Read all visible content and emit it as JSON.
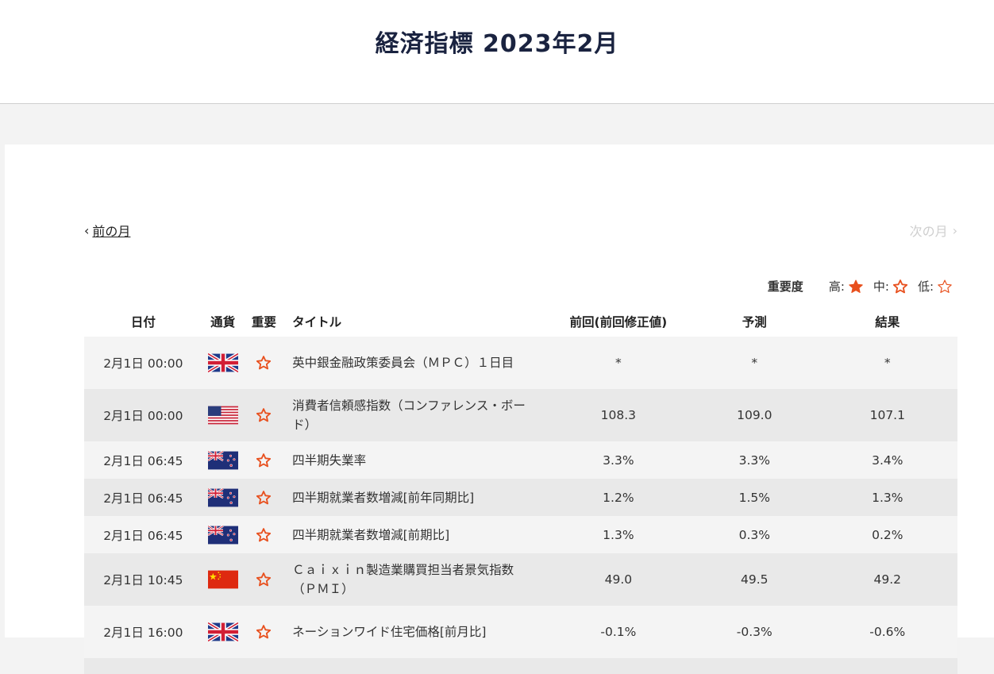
{
  "header": {
    "title": "経済指標 2023年2月"
  },
  "nav": {
    "prev_label": "前の月",
    "next_label": "次の月"
  },
  "legend": {
    "title": "重要度",
    "high": "高:",
    "mid": "中:",
    "low": "低:"
  },
  "table": {
    "headers": {
      "date": "日付",
      "currency": "通貨",
      "importance": "重要",
      "title": "タイトル",
      "previous": "前回(前回修正値)",
      "forecast": "予測",
      "result": "結果"
    },
    "rows": [
      {
        "date": "2月1日 00:00",
        "flag": "uk",
        "importance": "mid",
        "title": "英中銀金融政策委員会（ＭＰＣ）１日目",
        "previous": "*",
        "forecast": "*",
        "result": "*"
      },
      {
        "date": "2月1日 00:00",
        "flag": "us",
        "importance": "mid",
        "title": "消費者信頼感指数（コンファレンス・ボード）",
        "previous": "108.3",
        "forecast": "109.0",
        "result": "107.1"
      },
      {
        "date": "2月1日 06:45",
        "flag": "nz",
        "importance": "mid",
        "title": "四半期失業率",
        "previous": "3.3%",
        "forecast": "3.3%",
        "result": "3.4%"
      },
      {
        "date": "2月1日 06:45",
        "flag": "nz",
        "importance": "mid",
        "title": "四半期就業者数増減[前年同期比]",
        "previous": "1.2%",
        "forecast": "1.5%",
        "result": "1.3%"
      },
      {
        "date": "2月1日 06:45",
        "flag": "nz",
        "importance": "mid",
        "title": "四半期就業者数増減[前期比]",
        "previous": "1.3%",
        "forecast": "0.3%",
        "result": "0.2%"
      },
      {
        "date": "2月1日 10:45",
        "flag": "cn",
        "importance": "mid",
        "title": "Ｃａｉｘｉｎ製造業購買担当者景気指数（ＰＭＩ）",
        "previous": "49.0",
        "forecast": "49.5",
        "result": "49.2"
      },
      {
        "date": "2月1日 16:00",
        "flag": "uk",
        "importance": "mid",
        "title": "ネーションワイド住宅価格[前月比]",
        "previous": "-0.1%",
        "forecast": "-0.3%",
        "result": "-0.6%"
      }
    ]
  },
  "colors": {
    "accent": "#e8501e",
    "title": "#1a2340"
  }
}
